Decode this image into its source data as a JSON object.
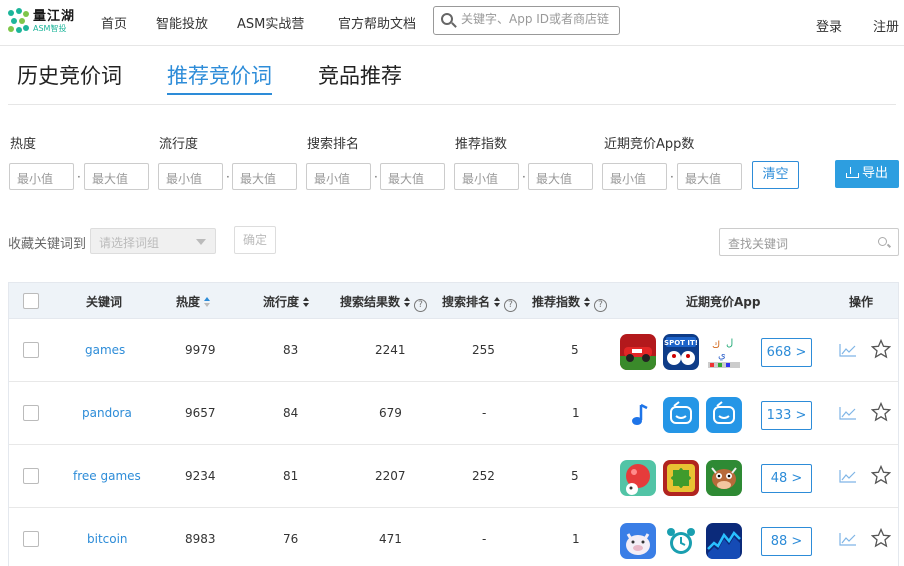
{
  "brand": {
    "name": "量江湖",
    "sub": "ASM智投"
  },
  "nav": {
    "items": [
      "首页",
      "智能投放",
      "ASM实战营",
      "官方帮助文档"
    ],
    "login": "登录",
    "register": "注册"
  },
  "search": {
    "placeholder": "关键字、App ID或者商店链"
  },
  "tabs": [
    {
      "label": "历史竞价词",
      "active": false
    },
    {
      "label": "推荐竞价词",
      "active": true
    },
    {
      "label": "竞品推荐",
      "active": false
    }
  ],
  "filters": {
    "labels": [
      "热度",
      "流行度",
      "搜索排名",
      "推荐指数",
      "近期竞价App数"
    ],
    "min_placeholder": "最小值",
    "max_placeholder": "最大值",
    "clear": "清空",
    "export": "导出"
  },
  "collect": {
    "label": "收藏关键词到",
    "select_placeholder": "请选择词组",
    "confirm": "确定",
    "search_placeholder": "查找关键词"
  },
  "table": {
    "headers": [
      "关键词",
      "热度",
      "流行度",
      "搜索结果数",
      "搜索排名",
      "推荐指数",
      "近期竞价App",
      "操作"
    ],
    "rows": [
      {
        "keyword": "games",
        "heat": "9979",
        "popularity": "83",
        "results": "2241",
        "rank": "255",
        "index": "5",
        "apps": "668 >"
      },
      {
        "keyword": "pandora",
        "heat": "9657",
        "popularity": "84",
        "results": "679",
        "rank": "-",
        "index": "1",
        "apps": "133 >"
      },
      {
        "keyword": "free games",
        "heat": "9234",
        "popularity": "81",
        "results": "2207",
        "rank": "252",
        "index": "5",
        "apps": "48 >"
      },
      {
        "keyword": "bitcoin",
        "heat": "8983",
        "popularity": "76",
        "results": "471",
        "rank": "-",
        "index": "1",
        "apps": "88 >"
      }
    ]
  },
  "icons": {
    "search": "search-icon",
    "download": "download-icon",
    "trend": "trend-chart-icon",
    "star": "star-icon",
    "accent": "#2d8cd8"
  }
}
